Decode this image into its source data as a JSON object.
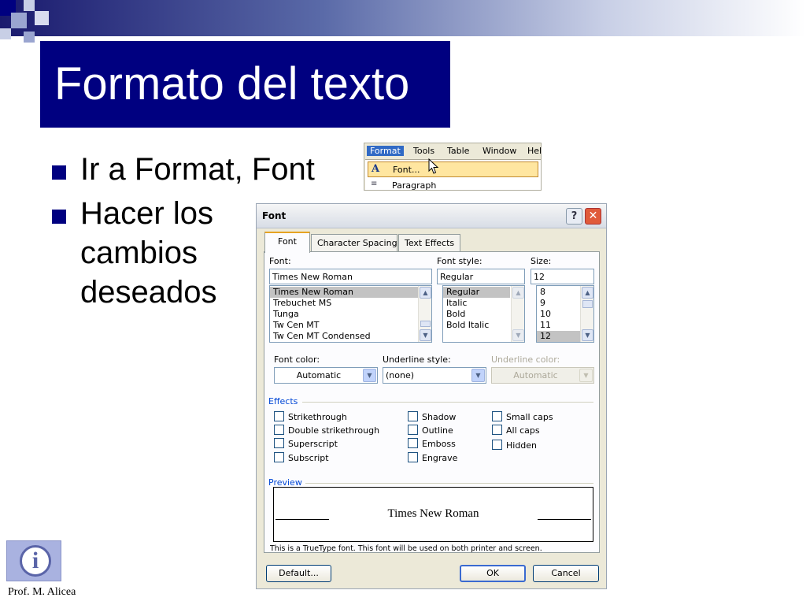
{
  "slide": {
    "title": "Formato del texto",
    "bullets": [
      "Ir a Format, Font",
      "Hacer los cambios deseados"
    ],
    "footer": "Prof. M. Alicea",
    "info_icon": "info-icon"
  },
  "menu_snippet": {
    "menubar": [
      "Format",
      "Tools",
      "Table",
      "Window",
      "Hel"
    ],
    "items": [
      "Font...",
      "Paragraph"
    ]
  },
  "dialog": {
    "title": "Font",
    "help_glyph": "?",
    "close_glyph": "✕",
    "tabs": [
      "Font",
      "Character Spacing",
      "Text Effects"
    ],
    "font": {
      "label": "Font:",
      "value": "Times New Roman",
      "list": [
        "Times New Roman",
        "Trebuchet MS",
        "Tunga",
        "Tw Cen MT",
        "Tw Cen MT Condensed"
      ],
      "selected": "Times New Roman"
    },
    "font_style": {
      "label": "Font style:",
      "value": "Regular",
      "list": [
        "Regular",
        "Italic",
        "Bold",
        "Bold Italic"
      ],
      "selected": "Regular"
    },
    "size": {
      "label": "Size:",
      "value": "12",
      "list": [
        "8",
        "9",
        "10",
        "11",
        "12"
      ],
      "selected": "12"
    },
    "font_color": {
      "label": "Font color:",
      "value": "Automatic"
    },
    "underline_style": {
      "label": "Underline style:",
      "value": "(none)"
    },
    "underline_color": {
      "label": "Underline color:",
      "value": "Automatic"
    },
    "effects": {
      "label": "Effects",
      "col1": [
        "Strikethrough",
        "Double strikethrough",
        "Superscript",
        "Subscript"
      ],
      "col2": [
        "Shadow",
        "Outline",
        "Emboss",
        "Engrave"
      ],
      "col3": [
        "Small caps",
        "All caps",
        "Hidden"
      ]
    },
    "preview": {
      "label": "Preview",
      "sample": "Times New Roman",
      "note": "This is a TrueType font. This font will be used on both printer and screen."
    },
    "buttons": {
      "default": "Default...",
      "ok": "OK",
      "cancel": "Cancel"
    }
  }
}
